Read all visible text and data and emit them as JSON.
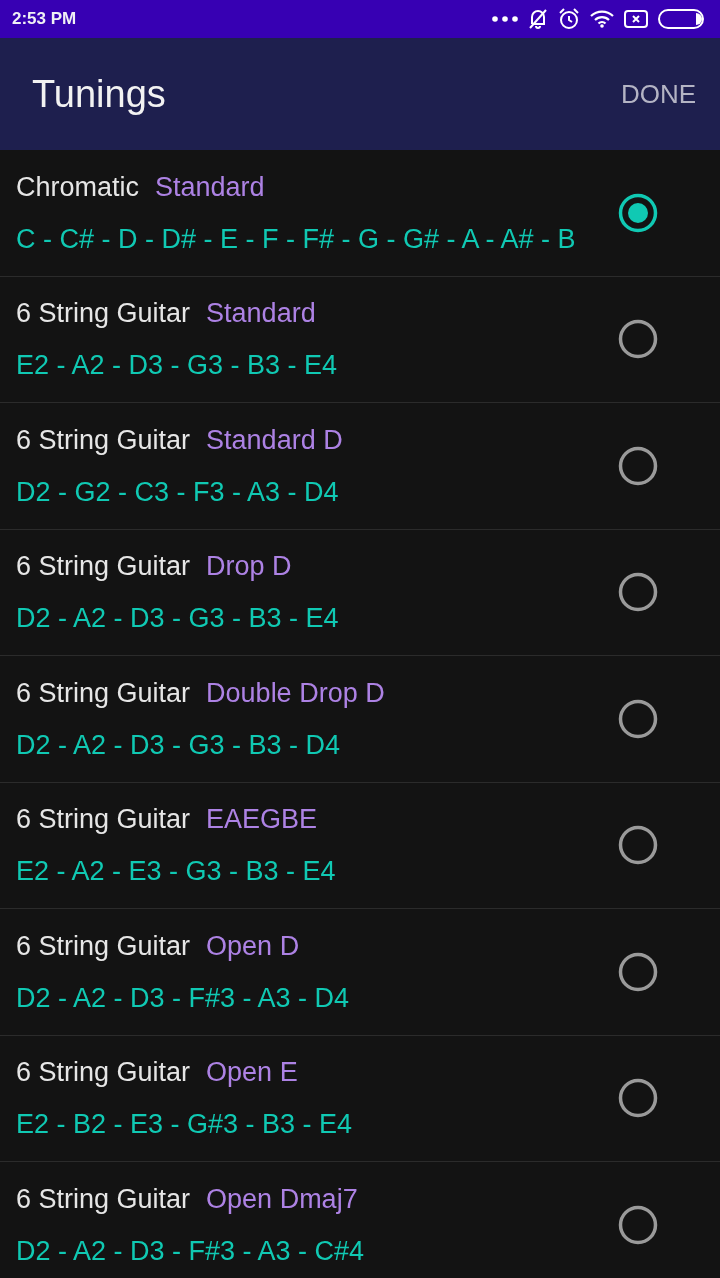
{
  "status_bar": {
    "time": "2:53 PM"
  },
  "app_bar": {
    "title": "Tunings",
    "action": "DONE"
  },
  "tunings": [
    {
      "instrument": "Chromatic",
      "name": "Standard",
      "notes": "C - C# - D - D# - E - F - F# - G - G# - A - A# - B",
      "selected": true
    },
    {
      "instrument": "6 String Guitar",
      "name": "Standard",
      "notes": "E2 - A2 - D3 - G3 - B3 - E4",
      "selected": false
    },
    {
      "instrument": "6 String Guitar",
      "name": "Standard D",
      "notes": "D2 - G2 - C3 - F3 - A3 - D4",
      "selected": false
    },
    {
      "instrument": "6 String Guitar",
      "name": "Drop D",
      "notes": "D2 - A2 - D3 - G3 - B3 - E4",
      "selected": false
    },
    {
      "instrument": "6 String Guitar",
      "name": "Double Drop D",
      "notes": "D2 - A2 - D3 - G3 - B3 - D4",
      "selected": false
    },
    {
      "instrument": "6 String Guitar",
      "name": "EAEGBE",
      "notes": "E2 - A2 - E3 - G3 - B3 - E4",
      "selected": false
    },
    {
      "instrument": "6 String Guitar",
      "name": "Open D",
      "notes": "D2 - A2 - D3 - F#3 - A3 - D4",
      "selected": false
    },
    {
      "instrument": "6 String Guitar",
      "name": "Open E",
      "notes": "E2 - B2 - E3 - G#3 - B3 - E4",
      "selected": false
    },
    {
      "instrument": "6 String Guitar",
      "name": "Open Dmaj7",
      "notes": "D2 - A2 - D3 - F#3 - A3 - C#4",
      "selected": false
    }
  ]
}
